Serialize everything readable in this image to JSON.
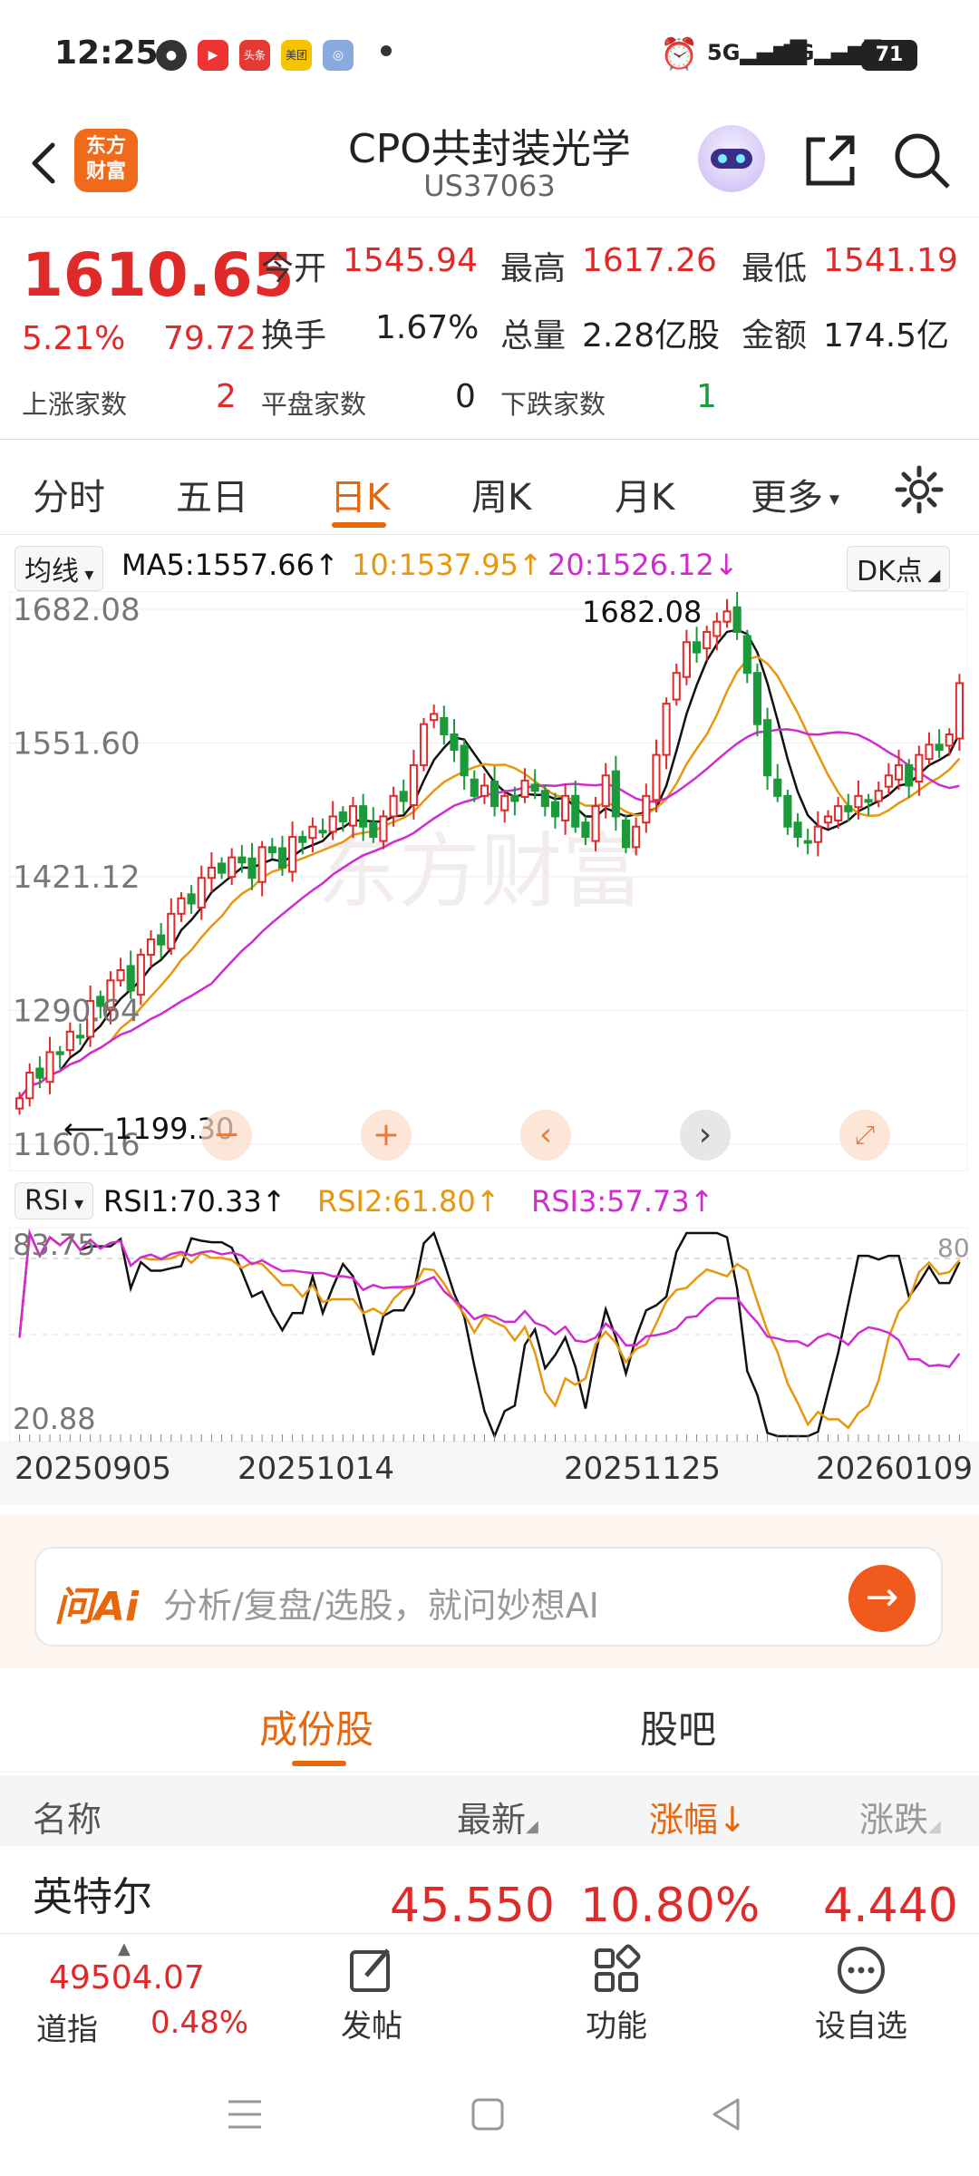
{
  "status_bar": {
    "time": "12:25",
    "battery": "71",
    "app_icons": [
      "wechat-icon",
      "video-app-icon",
      "toutiao-icon",
      "meituan-icon",
      "app-icon"
    ],
    "network": "5G"
  },
  "header": {
    "title": "CPO共封装光学",
    "code": "US37063",
    "logo_line1": "东方",
    "logo_line2": "财富"
  },
  "quote": {
    "price": "1610.65",
    "change_pct": "5.21%",
    "change": "79.72",
    "open_label": "今开",
    "open": "1545.94",
    "high_label": "最高",
    "high": "1617.26",
    "low_label": "最低",
    "low": "1541.19",
    "turnover_label": "换手",
    "turnover": "1.67%",
    "volume_label": "总量",
    "volume": "2.28亿股",
    "amount_label": "金额",
    "amount": "174.5亿",
    "up_label": "上涨家数",
    "up_count": "2",
    "flat_label": "平盘家数",
    "flat_count": "0",
    "down_label": "下跌家数",
    "down_count": "1"
  },
  "period_tabs": [
    "分时",
    "五日",
    "日K",
    "周K",
    "月K",
    "更多"
  ],
  "ma": {
    "selector": "均线",
    "ma5": "MA5:1557.66↑",
    "ma10": "10:1537.95↑",
    "ma20": "20:1526.12↓",
    "dk": "DK点"
  },
  "kline": {
    "y_labels": [
      "1682.08",
      "1551.60",
      "1421.12",
      "1290.64",
      "1160.16"
    ],
    "high_label": "1682.08",
    "low_label": "1199.30",
    "watermark": "东方财富"
  },
  "rsi": {
    "selector": "RSI",
    "rsi1": "RSI1:70.33↑",
    "rsi2": "RSI2:61.80↑",
    "rsi3": "RSI3:57.73↑",
    "y_top": "83.75",
    "y_bottom": "20.88",
    "level_80": "80"
  },
  "dates": [
    "20250905",
    "20251014",
    "20251125",
    "20260109"
  ],
  "ai": {
    "logo": "问Ai",
    "placeholder": "分析/复盘/选股，就问妙想AI"
  },
  "sub_tabs": [
    "成份股",
    "股吧"
  ],
  "table": {
    "headers": {
      "name": "名称",
      "latest": "最新",
      "change_pct": "涨幅",
      "change": "涨跌"
    },
    "rows": [
      {
        "name": "英特尔",
        "latest": "45.550",
        "change_pct": "10.80%",
        "change": "4.440"
      }
    ]
  },
  "bottom_bar": {
    "index_value": "49504.07",
    "index_name": "道指",
    "index_pct": "0.48%",
    "post": "发帖",
    "functions": "功能",
    "watchlist": "设自选"
  },
  "colors": {
    "up": "#e02a2a",
    "down": "#1a9a3a",
    "accent": "#e8660c",
    "ma5": "#111111",
    "ma10": "#e8960c",
    "ma20": "#d12ad1"
  },
  "chart_data": [
    {
      "type": "candlestick",
      "title": "",
      "yticks": [
        1682.08,
        1551.6,
        1421.12,
        1290.64,
        1160.16
      ],
      "ylim": [
        1160.16,
        1682.08
      ],
      "x_ticks": [
        "20250905",
        "20251014",
        "20251125",
        "20260109"
      ],
      "annotations": {
        "max": 1682.08,
        "min": 1199.3
      },
      "series": [
        {
          "name": "MA5",
          "last": 1557.66
        },
        {
          "name": "10",
          "last": 1537.95
        },
        {
          "name": "20",
          "last": 1526.12
        }
      ],
      "closes": [
        1205,
        1230,
        1225,
        1250,
        1248,
        1270,
        1265,
        1300,
        1295,
        1320,
        1330,
        1310,
        1345,
        1360,
        1355,
        1385,
        1400,
        1395,
        1420,
        1430,
        1425,
        1440,
        1435,
        1420,
        1450,
        1445,
        1430,
        1460,
        1455,
        1470,
        1465,
        1480,
        1475,
        1490,
        1470,
        1460,
        1480,
        1500,
        1495,
        1530,
        1570,
        1580,
        1560,
        1545,
        1520,
        1500,
        1510,
        1490,
        1500,
        1495,
        1515,
        1505,
        1490,
        1480,
        1500,
        1470,
        1460,
        1490,
        1520,
        1480,
        1450,
        1470,
        1500,
        1540,
        1590,
        1620,
        1650,
        1640,
        1660,
        1670,
        1680,
        1660,
        1620,
        1570,
        1520,
        1500,
        1470,
        1460,
        1455,
        1470,
        1480,
        1490,
        1485,
        1500,
        1495,
        1505,
        1520,
        1530,
        1510,
        1540,
        1550,
        1545,
        1560,
        1610
      ],
      "rsi": {
        "y_labels": [
          83.75,
          20.88
        ],
        "level": 80,
        "rsi1_last": 70.33,
        "rsi2_last": 61.8,
        "rsi3_last": 57.73
      }
    }
  ]
}
